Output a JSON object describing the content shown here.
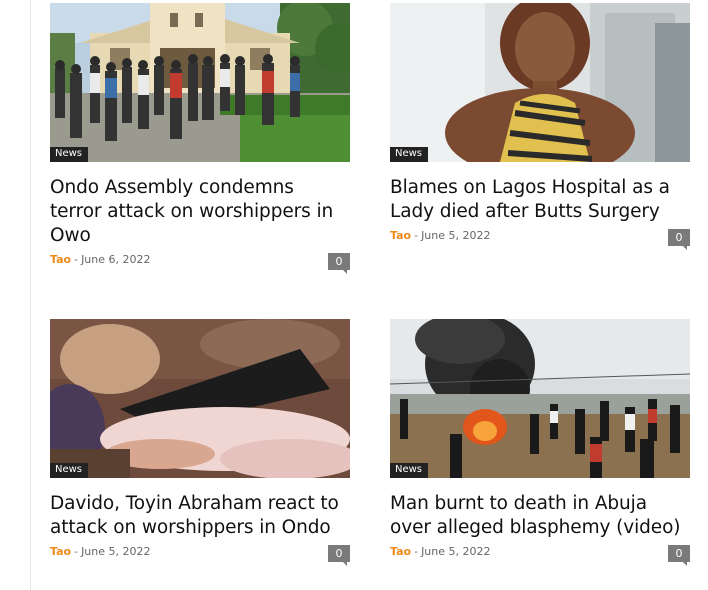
{
  "posts": [
    {
      "category": "News",
      "title": "Ondo Assembly condemns terror attack on worshippers in Owo",
      "author": "Tao",
      "separator": "-",
      "date": "June 6, 2022",
      "comments": "0",
      "image": "church-crowd-photo"
    },
    {
      "category": "News",
      "title": "Blames on Lagos Hospital as a Lady died after Butts Surgery",
      "author": "Tao",
      "separator": "-",
      "date": "June 5, 2022",
      "comments": "0",
      "image": "woman-portrait-photo"
    },
    {
      "category": "News",
      "title": "Davido, Toyin Abraham react to attack on worshippers in Ondo",
      "author": "Tao",
      "separator": "-",
      "date": "June 5, 2022",
      "comments": "0",
      "image": "blurred-scene-photo"
    },
    {
      "category": "News",
      "title": "Man burnt to death in Abuja over alleged blasphemy (video)",
      "author": "Tao",
      "separator": "-",
      "date": "June 5, 2022",
      "comments": "0",
      "image": "fire-crowd-photo"
    }
  ]
}
